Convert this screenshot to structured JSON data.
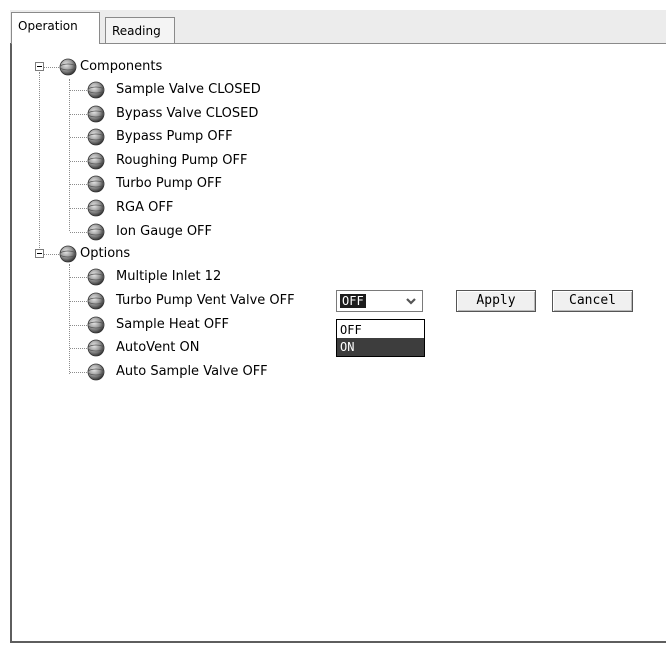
{
  "tabs": [
    {
      "label": "Operation",
      "active": true
    },
    {
      "label": "Reading",
      "active": false
    }
  ],
  "tree": {
    "components": {
      "label": "Components",
      "items": [
        "Sample Valve  CLOSED",
        "Bypass Valve  CLOSED",
        "Bypass Pump  OFF",
        "Roughing Pump  OFF",
        "Turbo Pump  OFF",
        "RGA  OFF",
        "Ion Gauge  OFF"
      ]
    },
    "options": {
      "label": "Options",
      "items": [
        "Multiple Inlet  12",
        "Turbo Pump Vent Valve  OFF",
        "Sample Heat  OFF",
        "AutoVent  ON",
        "Auto Sample Valve  OFF"
      ]
    }
  },
  "editor": {
    "selected_value": "OFF",
    "options": [
      "OFF",
      "ON"
    ],
    "highlighted_option": "ON",
    "apply_label": "Apply",
    "cancel_label": "Cancel"
  },
  "icons": {
    "expander": "collapse-minus-icon",
    "node": "gear-sphere-icon",
    "dropdown": "chevron-down-icon"
  }
}
